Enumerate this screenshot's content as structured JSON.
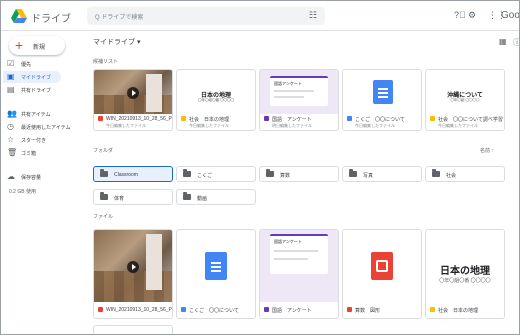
{
  "header": {
    "app_title": "ドライブ",
    "search_placeholder": "Q ドライブで検索",
    "partial_brand": "Goog"
  },
  "sidebar": {
    "new_label": "新規",
    "items": [
      {
        "label": "優先",
        "icon": "checkbox-icon",
        "active": false
      },
      {
        "label": "マイドライブ",
        "icon": "drive-icon",
        "active": true
      },
      {
        "label": "共有ドライブ",
        "icon": "shared-drive-icon",
        "active": false
      },
      {
        "label": "共有アイテム",
        "icon": "people-icon",
        "active": false
      },
      {
        "label": "最近使用したアイテム",
        "icon": "clock-icon",
        "active": false
      },
      {
        "label": "スター付き",
        "icon": "star-icon",
        "active": false
      },
      {
        "label": "ゴミ箱",
        "icon": "trash-icon",
        "active": false
      },
      {
        "label": "保存容量",
        "icon": "cloud-icon",
        "active": false
      }
    ],
    "storage_text": "0.2 GB 使用"
  },
  "main": {
    "breadcrumb": "マイドライブ ▾",
    "quick_access_label": "候補リスト",
    "folders_label": "フォルダ",
    "files_label": "ファイル",
    "sort_label": "名前 ↑",
    "quick_access": [
      {
        "name": "WIN_20210913_10_28_56_Pro",
        "sub": "今日編集したファイル",
        "kind": "video",
        "type_color": "#ea4335"
      },
      {
        "name": "社会　日本の地理",
        "sub": "今日編集したファイル",
        "kind": "doc-title",
        "title": "日本の地理",
        "doc_sub": "〇年〇組〇番 〇〇〇〇",
        "type_color": "#fbbc04"
      },
      {
        "name": "国語　アンケート",
        "sub": "明日編集したファイル",
        "kind": "form",
        "form_head": "国語アンケート",
        "type_color": "#673ab7"
      },
      {
        "name": "こくご　〇〇について",
        "sub": "今日編集したファイル",
        "kind": "bigdoc",
        "big_color": "#4285f4",
        "type_color": "#4285f4"
      },
      {
        "name": "社会　〇〇について調べ学習",
        "sub": "今日編集したファイル",
        "kind": "doc-title",
        "title": "沖縄について",
        "doc_sub": "〇年〇組 〇〇〇〇",
        "type_color": "#fbbc04"
      }
    ],
    "folders": [
      {
        "label": "Classroom",
        "selected": true
      },
      {
        "label": "こくご",
        "selected": false
      },
      {
        "label": "算数",
        "selected": false
      },
      {
        "label": "写真",
        "selected": false
      },
      {
        "label": "社会",
        "selected": false
      },
      {
        "label": "体育",
        "selected": false
      },
      {
        "label": "動画",
        "selected": false
      }
    ],
    "files": [
      {
        "name": "WIN_20210913_10_28_56_Pr",
        "kind": "video",
        "type_color": "#ea4335"
      },
      {
        "name": "こくご　〇〇について",
        "kind": "bigdoc",
        "big_color": "#4285f4",
        "type_color": "#4285f4"
      },
      {
        "name": "国語　アンケート",
        "kind": "form",
        "form_head": "国語アンケート",
        "type_color": "#673ab7"
      },
      {
        "name": "算数　図形",
        "kind": "bigdoc",
        "big_color": "#ea4335",
        "type_color": "#ea4335"
      },
      {
        "name": "社会　日本の地理",
        "kind": "doc-title",
        "title": "日本の地理",
        "doc_sub": "〇年〇組〇番 〇〇〇〇",
        "type_color": "#fbbc04"
      }
    ]
  }
}
